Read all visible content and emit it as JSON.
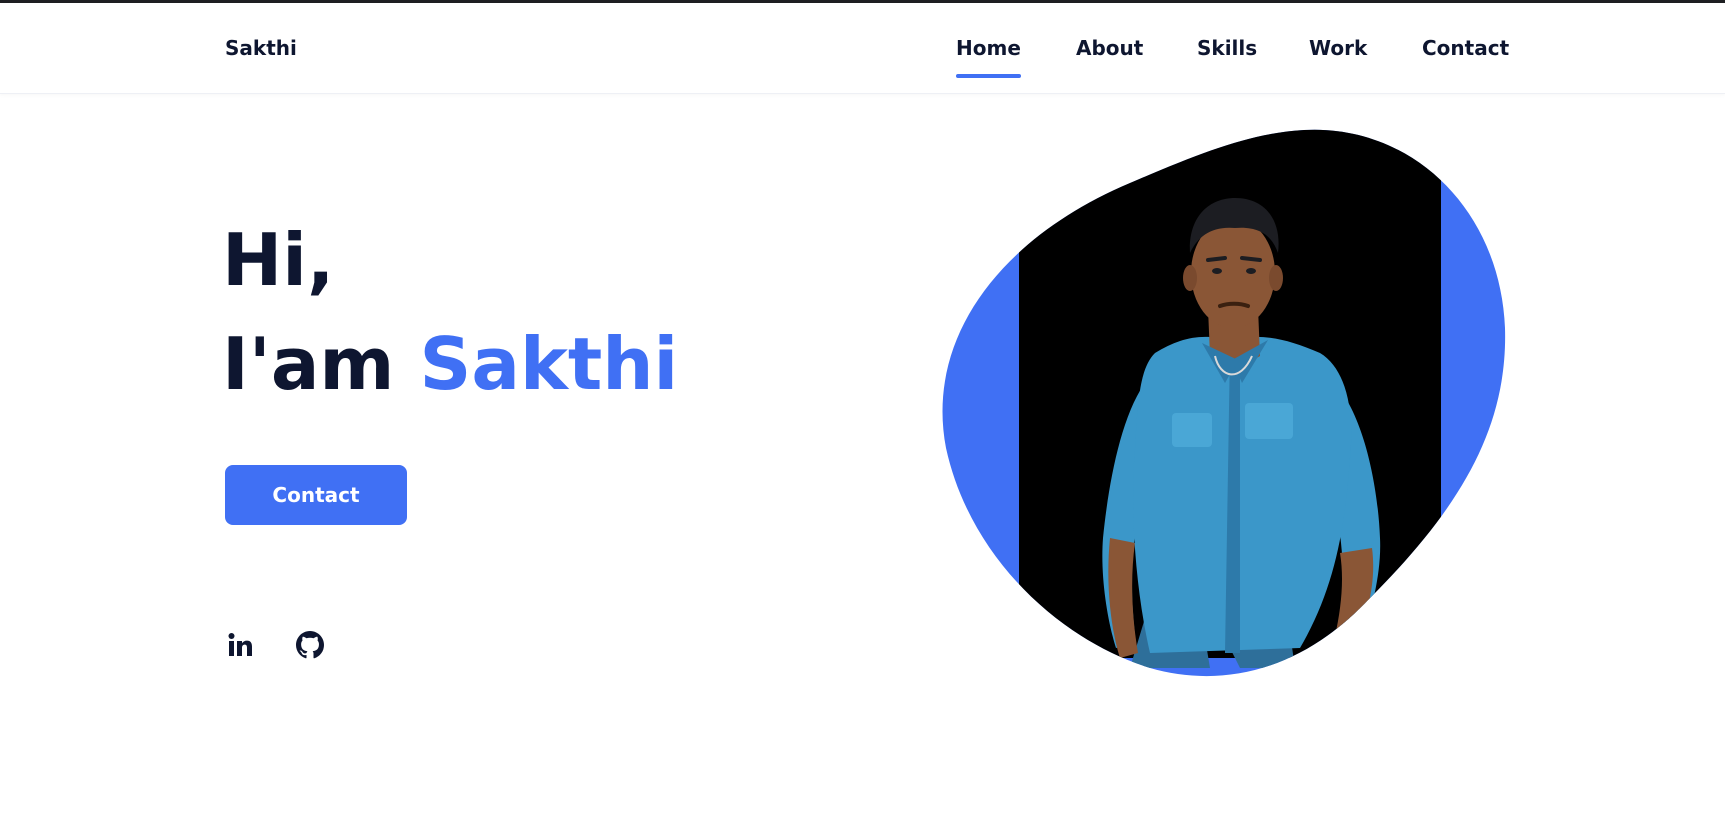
{
  "header": {
    "logo": "Sakthi",
    "nav": [
      {
        "label": "Home",
        "active": true
      },
      {
        "label": "About",
        "active": false
      },
      {
        "label": "Skills",
        "active": false
      },
      {
        "label": "Work",
        "active": false
      },
      {
        "label": "Contact",
        "active": false
      }
    ]
  },
  "hero": {
    "greeting": "Hi,",
    "intro_prefix": "I'am",
    "name": "Sakthi",
    "contact_button": "Contact"
  },
  "social": [
    {
      "name": "linkedin",
      "icon": "linkedin-icon"
    },
    {
      "name": "github",
      "icon": "github-icon"
    }
  ],
  "colors": {
    "accent": "#4070f4",
    "text": "#0e1630",
    "photo_bg": "#000000",
    "shirt": "#3b97c9",
    "skin": "#8a5636",
    "hair": "#1c1d22"
  }
}
